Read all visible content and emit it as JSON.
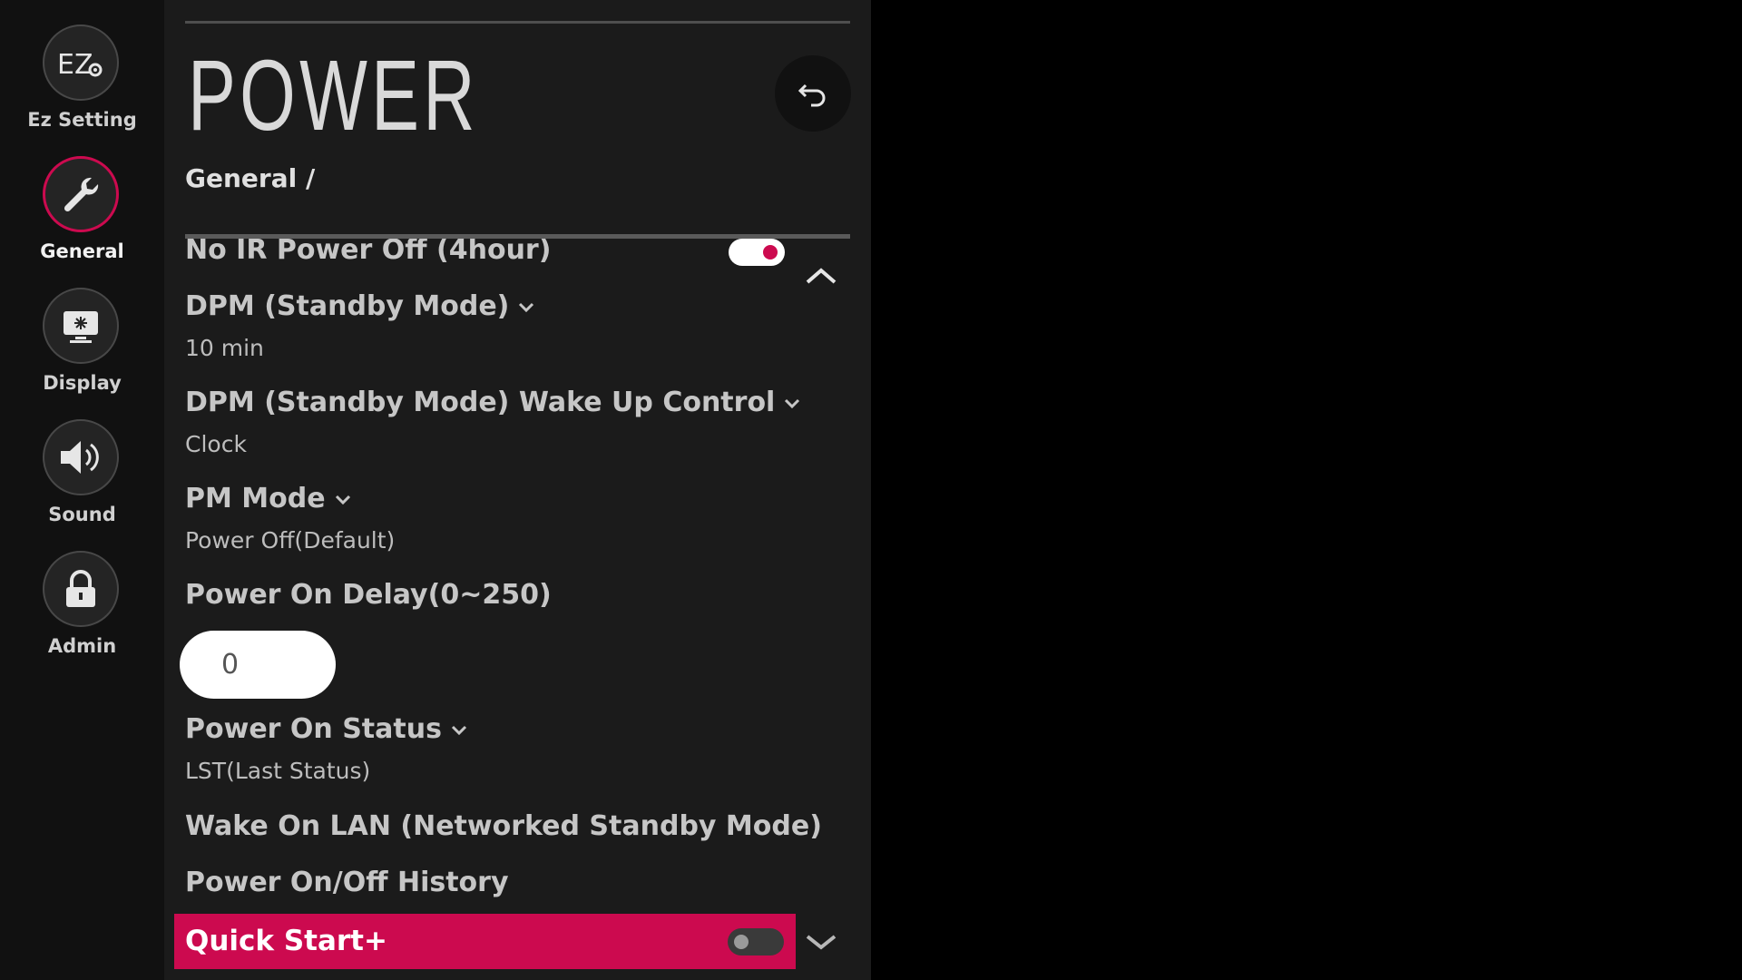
{
  "nav": {
    "items": [
      {
        "label": "Ez Setting",
        "icon": "ez-setting-icon"
      },
      {
        "label": "General",
        "icon": "wrench-icon",
        "active": true
      },
      {
        "label": "Display",
        "icon": "display-icon"
      },
      {
        "label": "Sound",
        "icon": "speaker-icon"
      },
      {
        "label": "Admin",
        "icon": "lock-icon"
      }
    ],
    "ez_glyph": "EZ"
  },
  "header": {
    "title": "POWER",
    "breadcrumb": "General /",
    "back_icon": "back-arrow-icon"
  },
  "settings": {
    "no_ir_power_off": {
      "label": "No IR Power Off (4hour)",
      "toggle_on": true
    },
    "dpm": {
      "label": "DPM (Standby Mode)",
      "value": "10 min"
    },
    "dpm_wake": {
      "label": "DPM (Standby Mode) Wake Up Control",
      "value": "Clock"
    },
    "pm_mode": {
      "label": "PM Mode",
      "value": "Power Off(Default)"
    },
    "power_on_delay": {
      "label": "Power On Delay(0~250)",
      "value": "0"
    },
    "power_on_status": {
      "label": "Power On Status",
      "value": "LST(Last Status)"
    },
    "wake_on_lan": {
      "label": "Wake On LAN (Networked Standby Mode)"
    },
    "power_history": {
      "label": "Power On/Off History"
    },
    "quick_start": {
      "label": "Quick Start+",
      "toggle_on": false
    }
  },
  "colors": {
    "accent": "#cc0a4f",
    "panel": "#1b1b1b",
    "nav": "#111111"
  }
}
